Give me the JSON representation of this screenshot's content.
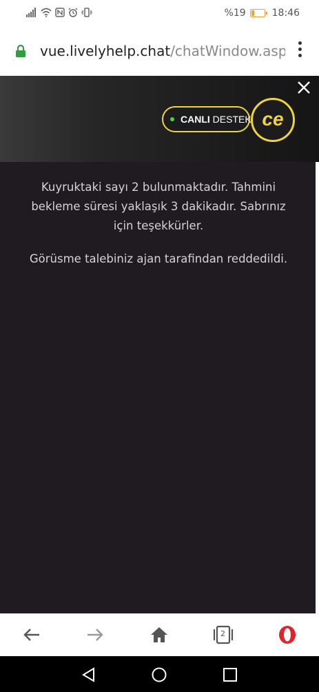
{
  "status_bar": {
    "battery_percent": "%19",
    "time": "18:46",
    "icons": [
      "signal-icon",
      "wifi-icon",
      "nfc-icon",
      "alarm-icon",
      "vibrate-icon"
    ]
  },
  "address_bar": {
    "url_host": "vue.livelyhelp.chat",
    "url_path": "/chatWindow.aspx?s"
  },
  "chat_header": {
    "brand_label_bold": "CANLI",
    "brand_label_rest": " DESTEK",
    "brand_logo_text": "ce",
    "online_color": "#46d246",
    "accent_color": "#f1d33a"
  },
  "messages": [
    "Kuyruktaki sayı 2 bulunmaktadır. Tahmini bekleme süresi yaklaşık 3 dakikadır. Sabrınız için teşekkürler.",
    "Görüsme talebiniz ajan tarafindan reddedildi."
  ],
  "browser_nav": {
    "tab_count": "2",
    "icons": [
      "back-arrow-icon",
      "forward-arrow-icon",
      "home-icon",
      "tabs-icon",
      "opera-icon"
    ],
    "opera_color": "#e0242a"
  },
  "system_nav": {
    "icons": [
      "back-triangle-icon",
      "home-circle-icon",
      "recents-square-icon"
    ]
  }
}
